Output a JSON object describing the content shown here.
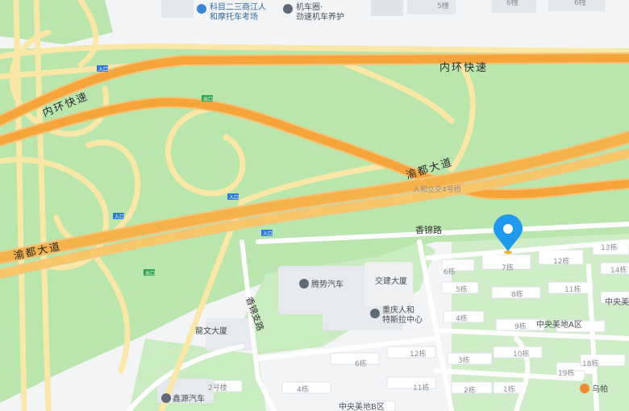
{
  "map": {
    "roads": {
      "inner_ring_top": "内环快速",
      "inner_ring_left": "内环快速",
      "yudu_right": "渝都大道",
      "yudu_left": "渝都大道",
      "xiangjin": "香锦路",
      "xiangjin_zhi": "香锦支路",
      "left_edge_road": "内环快速"
    },
    "pois": {
      "kemu": "科目二三商江人和摩托车考场",
      "kemu_line1": "科目二三商江人",
      "kemu_line2": "和摩托车考场",
      "jiche_line1": "机车圈·",
      "jiche_line2": "劲速机车养护",
      "tengshi": "腾势汽车",
      "tesila_line1": "重庆人和",
      "tesila_line2": "特斯拉中心",
      "xinyuan": "鑫源汽车",
      "jiaojian": "交建大厦",
      "longwen": "龍文大厦",
      "guochao": "乌帕",
      "zhongyang_a": "中央美地A区",
      "zhongyang_b": "中央美地B区",
      "zhongyang_right": "中央美",
      "renhe_station": "人和立交4号桥"
    },
    "ramps": [
      "入口",
      "入口",
      "入口",
      "入口",
      "出口",
      "出口"
    ],
    "buildings": [
      "6栋",
      "7栋",
      "12栋",
      "13栋",
      "5栋",
      "8栋",
      "11栋",
      "14栋",
      "4栋",
      "9栋",
      "3栋",
      "10栋",
      "2栋",
      "1栋",
      "19栋",
      "18栋",
      "12栋",
      "6栋",
      "4栋",
      "11栋",
      "2号楼",
      "5幢",
      "6幢",
      "4栋",
      "6幢"
    ],
    "marker": {
      "name": "location-pin",
      "color": "#1e9bf0"
    },
    "colors": {
      "background": "#f3f4f6",
      "green": "#b8e6ad",
      "expressway": "#f6a43a",
      "expressway_edge": "#f3c57a",
      "ramp": "#fbe7a7",
      "ramp_edge": "#f0d27a"
    }
  }
}
